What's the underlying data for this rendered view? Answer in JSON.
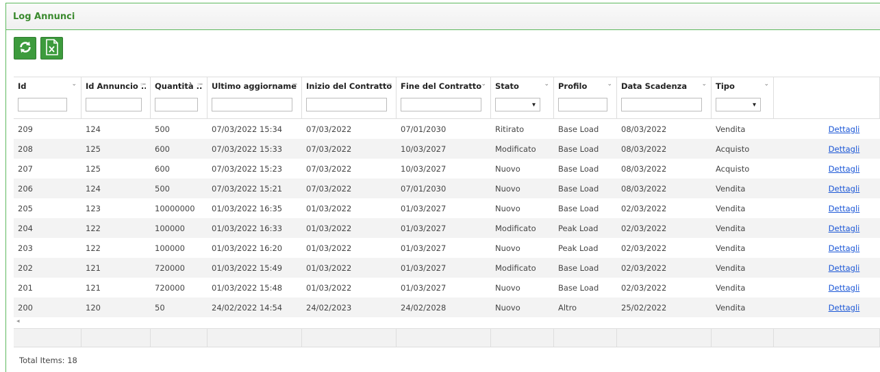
{
  "panel": {
    "title": "Log Annunci"
  },
  "toolbar": {
    "refresh_icon": "refresh-icon",
    "excel_icon": "excel-export-icon"
  },
  "columns": [
    {
      "label": "Id",
      "icon": "chevron-down-icon"
    },
    {
      "label": "Id Annuncio ...",
      "icon": "sort-icon"
    },
    {
      "label": "Quantità ...",
      "icon": "sort-icon"
    },
    {
      "label": "Ultimo aggiorname...",
      "icon": "sort-icon"
    },
    {
      "label": "Inizio del Contratto...",
      "icon": "sort-icon"
    },
    {
      "label": "Fine del Contratto",
      "icon": "chevron-down-icon"
    },
    {
      "label": "Stato",
      "icon": "chevron-down-icon"
    },
    {
      "label": "Profilo",
      "icon": "chevron-down-icon"
    },
    {
      "label": "Data Scadenza",
      "icon": "chevron-down-icon"
    },
    {
      "label": "Tipo",
      "icon": "chevron-down-icon"
    },
    {
      "label": "",
      "icon": ""
    }
  ],
  "rows": [
    [
      "209",
      "124",
      "500",
      "07/03/2022 15:34",
      "07/03/2022",
      "07/01/2030",
      "Ritirato",
      "Base Load",
      "08/03/2022",
      "Vendita",
      "Dettagli"
    ],
    [
      "208",
      "125",
      "600",
      "07/03/2022 15:33",
      "07/03/2022",
      "10/03/2027",
      "Modificato",
      "Base Load",
      "08/03/2022",
      "Acquisto",
      "Dettagli"
    ],
    [
      "207",
      "125",
      "600",
      "07/03/2022 15:23",
      "07/03/2022",
      "10/03/2027",
      "Nuovo",
      "Base Load",
      "08/03/2022",
      "Acquisto",
      "Dettagli"
    ],
    [
      "206",
      "124",
      "500",
      "07/03/2022 15:21",
      "07/03/2022",
      "07/01/2030",
      "Nuovo",
      "Base Load",
      "08/03/2022",
      "Vendita",
      "Dettagli"
    ],
    [
      "205",
      "123",
      "10000000",
      "01/03/2022 16:35",
      "01/03/2022",
      "01/03/2027",
      "Nuovo",
      "Base Load",
      "02/03/2022",
      "Vendita",
      "Dettagli"
    ],
    [
      "204",
      "122",
      "100000",
      "01/03/2022 16:33",
      "01/03/2022",
      "01/03/2027",
      "Modificato",
      "Peak Load",
      "02/03/2022",
      "Vendita",
      "Dettagli"
    ],
    [
      "203",
      "122",
      "100000",
      "01/03/2022 16:20",
      "01/03/2022",
      "01/03/2027",
      "Nuovo",
      "Peak Load",
      "02/03/2022",
      "Vendita",
      "Dettagli"
    ],
    [
      "202",
      "121",
      "720000",
      "01/03/2022 15:49",
      "01/03/2022",
      "01/03/2027",
      "Modificato",
      "Base Load",
      "02/03/2022",
      "Vendita",
      "Dettagli"
    ],
    [
      "201",
      "121",
      "720000",
      "01/03/2022 15:48",
      "01/03/2022",
      "01/03/2027",
      "Nuovo",
      "Base Load",
      "02/03/2022",
      "Vendita",
      "Dettagli"
    ],
    [
      "200",
      "120",
      "50",
      "24/02/2022 14:54",
      "24/02/2023",
      "24/02/2028",
      "Nuovo",
      "Altro",
      "25/02/2022",
      "Vendita",
      "Dettagli"
    ]
  ],
  "filters": {
    "types": [
      "text",
      "text",
      "text",
      "text",
      "text",
      "text",
      "select",
      "text",
      "text",
      "select",
      "none"
    ],
    "select_caret": "▾"
  },
  "scroll_arrow": "◂",
  "footer": {
    "total_items": "Total Items: 18"
  },
  "colors": {
    "accent": "#3d9b3d",
    "link": "#1a56d6",
    "title": "#3a8a2e"
  }
}
